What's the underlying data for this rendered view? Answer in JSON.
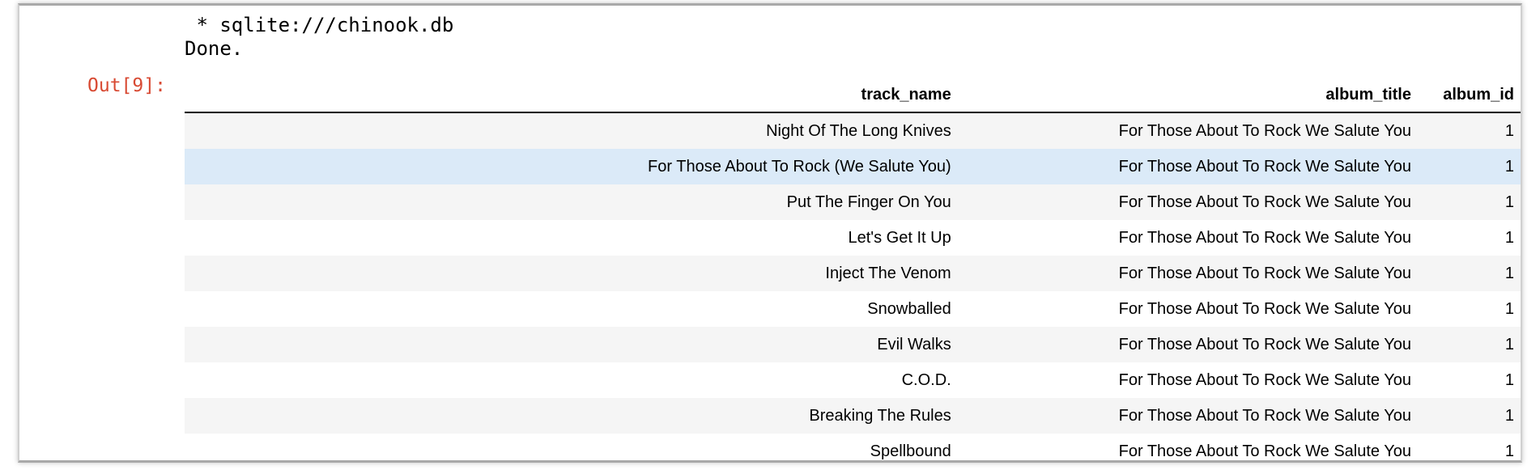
{
  "output": {
    "connection_line": " * sqlite:///chinook.db",
    "status_line": "Done.",
    "prompt": "Out[9]:"
  },
  "table": {
    "columns": [
      "track_name",
      "album_title",
      "album_id"
    ],
    "rows": [
      {
        "track_name": "Night Of The Long Knives",
        "album_title": "For Those About To Rock We Salute You",
        "album_id": "1"
      },
      {
        "track_name": "For Those About To Rock (We Salute You)",
        "album_title": "For Those About To Rock We Salute You",
        "album_id": "1"
      },
      {
        "track_name": "Put The Finger On You",
        "album_title": "For Those About To Rock We Salute You",
        "album_id": "1"
      },
      {
        "track_name": "Let's Get It Up",
        "album_title": "For Those About To Rock We Salute You",
        "album_id": "1"
      },
      {
        "track_name": "Inject The Venom",
        "album_title": "For Those About To Rock We Salute You",
        "album_id": "1"
      },
      {
        "track_name": "Snowballed",
        "album_title": "For Those About To Rock We Salute You",
        "album_id": "1"
      },
      {
        "track_name": "Evil Walks",
        "album_title": "For Those About To Rock We Salute You",
        "album_id": "1"
      },
      {
        "track_name": "C.O.D.",
        "album_title": "For Those About To Rock We Salute You",
        "album_id": "1"
      },
      {
        "track_name": "Breaking The Rules",
        "album_title": "For Those About To Rock We Salute You",
        "album_id": "1"
      },
      {
        "track_name": "Spellbound",
        "album_title": "For Those About To Rock We Salute You",
        "album_id": "1"
      }
    ],
    "highlighted_row": 1
  },
  "colors": {
    "prompt": "#d84a33",
    "row_stripe": "#f5f5f5",
    "row_hover": "#dbeaf8"
  }
}
